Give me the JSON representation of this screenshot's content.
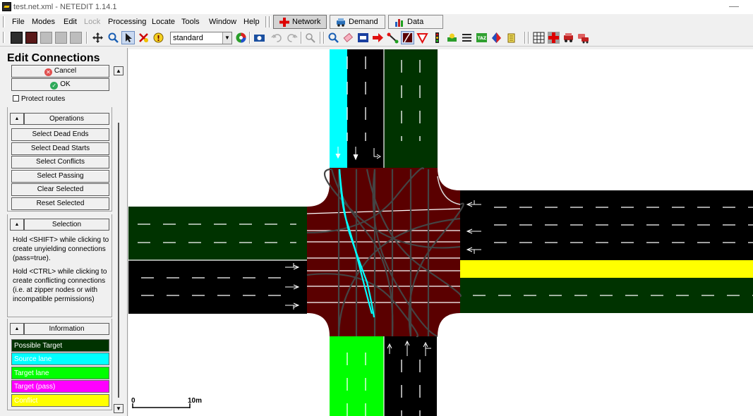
{
  "window": {
    "title": "test.net.xml - NETEDIT 1.14.1",
    "minimize_glyph": "—"
  },
  "menu": {
    "file": "File",
    "modes": "Modes",
    "edit": "Edit",
    "lock": "Lock",
    "processing": "Processing",
    "locate": "Locate",
    "tools": "Tools",
    "window": "Window",
    "help": "Help"
  },
  "supermodes": {
    "network": "Network",
    "demand": "Demand",
    "data": "Data"
  },
  "toolbar": {
    "view_scheme": "standard"
  },
  "panel": {
    "title": "Edit Connections",
    "cancel": "Cancel",
    "ok": "OK",
    "protect_routes": "Protect routes",
    "operations": {
      "label": "Operations",
      "buttons": [
        "Select Dead Ends",
        "Select Dead Starts",
        "Select Conflicts",
        "Select Passing",
        "Clear Selected",
        "Reset Selected"
      ]
    },
    "selection": {
      "label": "Selection",
      "help1": "Hold <SHIFT> while clicking to create unyielding connections (pass=true).",
      "help2": "Hold <CTRL> while clicking to create conflicting connections (i.e. at zipper nodes or with incompatible permissions)"
    },
    "information": {
      "label": "Information",
      "legend": [
        {
          "label": "Possible Target",
          "color": "#003300",
          "text_color": "#ffffff"
        },
        {
          "label": "Source lane",
          "color": "#00ffff",
          "text_color": "#ffffff"
        },
        {
          "label": "Target lane",
          "color": "#00ff00",
          "text_color": "#ffffff"
        },
        {
          "label": "Target (pass)",
          "color": "#ff00ff",
          "text_color": "#ffffff"
        },
        {
          "label": "Conflict",
          "color": "#ffff00",
          "text_color": "#ffffff"
        }
      ]
    }
  },
  "map": {
    "scale_zero": "0",
    "scale_max": "10m",
    "colors": {
      "junction": "#5a0000",
      "possible_target": "#003300",
      "source_lane": "#00ffff",
      "target_lane": "#00ff00",
      "conflict": "#ffff00",
      "lane": "#000000"
    }
  }
}
